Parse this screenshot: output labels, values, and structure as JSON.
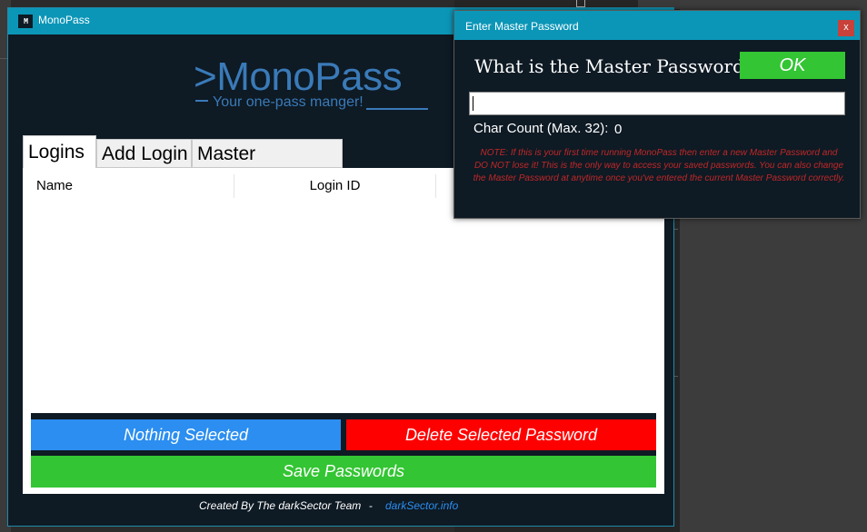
{
  "main_window": {
    "title": "MonoPass",
    "icon_label": "M",
    "logo": ">MonoPass",
    "tagline": "Your one-pass manger!",
    "tabs": [
      {
        "label": "Logins",
        "active": true
      },
      {
        "label": "Add Login",
        "active": false
      },
      {
        "label": "Master Password",
        "active": false
      }
    ],
    "list": {
      "columns": [
        "Name",
        "Login ID",
        ""
      ],
      "rows": []
    },
    "buttons": {
      "nothing_selected": "Nothing Selected",
      "delete_selected": "Delete Selected Password",
      "save": "Save Passwords"
    },
    "footer": {
      "credit": "Created By The darkSector Team",
      "separator": "-",
      "link": "darkSector.info"
    }
  },
  "dialog": {
    "title": "Enter Master Password",
    "close_label": "x",
    "question": "What is the Master Password?",
    "ok_label": "OK",
    "password_value": "",
    "char_count_label": "Char Count (Max. 32):",
    "char_count_value": "0",
    "note": "NOTE: If this is your first time running MonoPass then enter a new Master Password and DO NOT lose it! This is the only way to access your saved passwords. You can also change the Master Password at anytime once you've entered the current Master Password correctly."
  },
  "colors": {
    "titlebar": "#0b96b8",
    "window_bg": "#0e1a24",
    "logo": "#3a7ab8",
    "button_blue": "#2b8ef0",
    "button_red": "#ff0000",
    "button_green": "#33c533",
    "note_red": "#c02828"
  }
}
